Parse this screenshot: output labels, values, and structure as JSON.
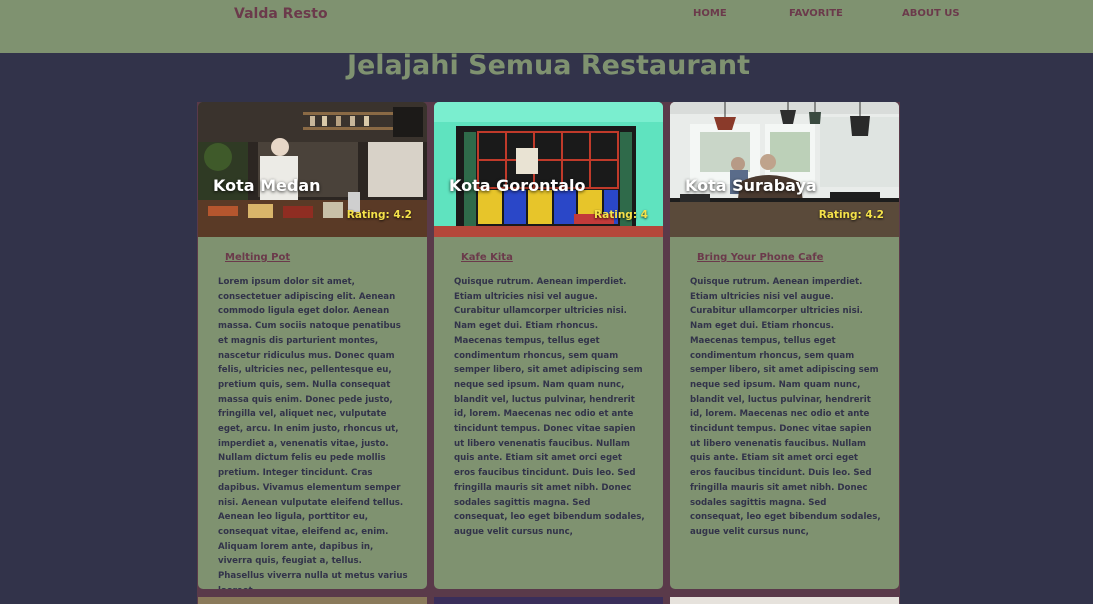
{
  "header": {
    "brand": "Valda Resto",
    "nav": [
      "HOME",
      "FAVORITE",
      "ABOUT US"
    ]
  },
  "page_title": "Jelajahi Semua Restaurant",
  "colors": {
    "header_bg": "#7f9270",
    "page_bg": "#32334a",
    "accent": "#6b3a4b",
    "rating": "#f5e24a"
  },
  "restaurants": [
    {
      "city": "Kota Medan",
      "rating": "Rating: 4.2",
      "name": "Melting Pot",
      "description": "Lorem ipsum dolor sit amet, consectetuer adipiscing elit. Aenean commodo ligula eget dolor. Aenean massa. Cum sociis natoque penatibus et magnis dis parturient montes, nascetur ridiculus mus. Donec quam felis, ultricies nec, pellentesque eu, pretium quis, sem. Nulla consequat massa quis enim. Donec pede justo, fringilla vel, aliquet nec, vulputate eget, arcu. In enim justo, rhoncus ut, imperdiet a, venenatis vitae, justo. Nullam dictum felis eu pede mollis pretium. Integer tincidunt. Cras dapibus. Vivamus elementum semper nisi. Aenean vulputate eleifend tellus. Aenean leo ligula, porttitor eu, consequat vitae, eleifend ac, enim. Aliquam lorem ante, dapibus in, viverra quis, feugiat a, tellus. Phasellus viverra nulla ut metus varius laoreet."
    },
    {
      "city": "Kota Gorontalo",
      "rating": "Rating: 4",
      "name": "Kafe Kita",
      "description": "Quisque rutrum. Aenean imperdiet. Etiam ultricies nisi vel augue. Curabitur ullamcorper ultricies nisi. Nam eget dui. Etiam rhoncus. Maecenas tempus, tellus eget condimentum rhoncus, sem quam semper libero, sit amet adipiscing sem neque sed ipsum. Nam quam nunc, blandit vel, luctus pulvinar, hendrerit id, lorem. Maecenas nec odio et ante tincidunt tempus. Donec vitae sapien ut libero venenatis faucibus. Nullam quis ante. Etiam sit amet orci eget eros faucibus tincidunt. Duis leo. Sed fringilla mauris sit amet nibh. Donec sodales sagittis magna. Sed consequat, leo eget bibendum sodales, augue velit cursus nunc,"
    },
    {
      "city": "Kota Surabaya",
      "rating": "Rating: 4.2",
      "name": "Bring Your Phone Cafe",
      "description": "Quisque rutrum. Aenean imperdiet. Etiam ultricies nisi vel augue. Curabitur ullamcorper ultricies nisi. Nam eget dui. Etiam rhoncus. Maecenas tempus, tellus eget condimentum rhoncus, sem quam semper libero, sit amet adipiscing sem neque sed ipsum. Nam quam nunc, blandit vel, luctus pulvinar, hendrerit id, lorem. Maecenas nec odio et ante tincidunt tempus. Donec vitae sapien ut libero venenatis faucibus. Nullam quis ante. Etiam sit amet orci eget eros faucibus tincidunt. Duis leo. Sed fringilla mauris sit amet nibh. Donec sodales sagittis magna. Sed consequat, leo eget bibendum sodales, augue velit cursus nunc,"
    }
  ]
}
